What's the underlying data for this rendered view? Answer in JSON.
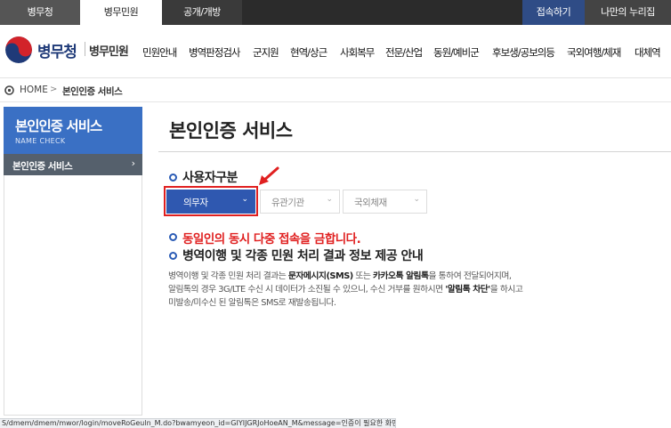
{
  "top_tabs": [
    "병무청",
    "병무민원",
    "공개/개방",
    "접속하기",
    "나만의 누리집"
  ],
  "logo": {
    "main": "병무청",
    "sub": "병무민원"
  },
  "gnb": [
    "민원안내",
    "병역판정검사",
    "군지원",
    "현역/상근",
    "사회복무",
    "전문/산업",
    "동원/예비군",
    "후보생/공보의등",
    "국외여행/체재",
    "대체역"
  ],
  "breadcrumb": {
    "home": "HOME",
    "sep": ">",
    "current": "본인인증 서비스"
  },
  "sidebar": {
    "title": "본인인증 서비스",
    "subtitle": "NAME CHECK",
    "item": "본인인증 서비스",
    "item_arrow": "›"
  },
  "main": {
    "title": "본인인증 서비스",
    "user_type_label": "사용자구분",
    "selects": [
      {
        "label": "의무자",
        "selected": true
      },
      {
        "label": "유관기관",
        "selected": false
      },
      {
        "label": "국외체재",
        "selected": false
      }
    ],
    "notice": "동일인의 동시 다중 접속을 금합니다.",
    "info_heading": "병역이행 및 각종 민원 처리 결과 정보 제공 안내",
    "info_lines": [
      [
        "병역이행 및 각종 민원 처리 결과는 ",
        "문자메시지(SMS)",
        " 또는 ",
        "카카오톡 알림톡",
        "을 통하여 전달되어지며,"
      ],
      [
        "알림톡의 경우 3G/LTE 수신 시 데이터가 소진될 수 있으니, 수신 거부를 원하시면 ",
        "'알림톡 차단'",
        "을 하시고"
      ],
      [
        "미발송/미수신 된 알림톡은 SMS로 재발송됩니다."
      ]
    ]
  },
  "status_url": "S/dmem/dmem/mwor/login/moveRoGeuln_M.do?bwamyeon_id=GIYIJGRJoHoeAN_M&message=인증이 필요한 화면입니다.#n",
  "colors": {
    "accent_blue": "#2f58b0",
    "warning_red": "#e02020",
    "sidebar_blue": "#3a70c4",
    "sidebar_item": "#55606c"
  },
  "icons": [
    "home-icon",
    "chevron-down-icon",
    "arrow-right-icon",
    "bullet-circle-icon",
    "annotation-arrow-icon"
  ]
}
